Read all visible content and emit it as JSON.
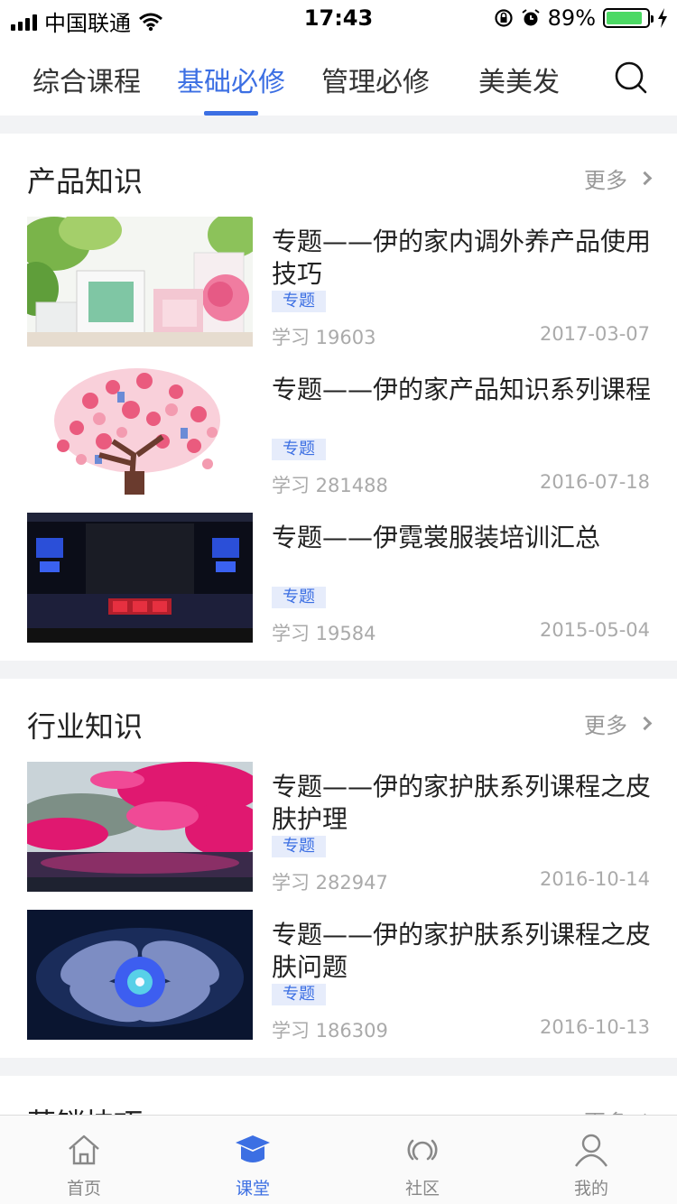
{
  "status_bar": {
    "carrier": "中国联通",
    "time": "17:43",
    "battery": "89%",
    "battery_level": 0.89,
    "icons": [
      "signal-icon",
      "wifi-icon",
      "rotation-lock-icon",
      "alarm-icon",
      "battery-icon",
      "charging-icon"
    ]
  },
  "top_tabs": {
    "items": [
      {
        "label": "综合课程",
        "active": false
      },
      {
        "label": "基础必修",
        "active": true
      },
      {
        "label": "管理必修",
        "active": false
      },
      {
        "label": "美美发",
        "active": false
      }
    ],
    "search_icon": "search-icon",
    "accent_color": "#3c6fe3"
  },
  "sections": [
    {
      "title": "产品知识",
      "more": "更多",
      "items": [
        {
          "title": "专题——伊的家内调外养产品使用技巧",
          "badge": "专题",
          "learn": "学习 19603",
          "date": "2017-03-07"
        },
        {
          "title": "专题——伊的家产品知识系列课程",
          "badge": "专题",
          "learn": "学习 281488",
          "date": "2016-07-18"
        },
        {
          "title": "专题——伊霓裳服装培训汇总",
          "badge": "专题",
          "learn": "学习 19584",
          "date": "2015-05-04"
        }
      ]
    },
    {
      "title": "行业知识",
      "more": "更多",
      "items": [
        {
          "title": "专题——伊的家护肤系列课程之皮肤护理",
          "badge": "专题",
          "learn": "学习 282947",
          "date": "2016-10-14"
        },
        {
          "title": "专题——伊的家护肤系列课程之皮肤问题",
          "badge": "专题",
          "learn": "学习 186309",
          "date": "2016-10-13"
        }
      ]
    },
    {
      "title": "营销技巧",
      "more": "更多",
      "items": []
    }
  ],
  "tab_bar": {
    "items": [
      {
        "label": "首页",
        "icon": "home-icon",
        "active": false
      },
      {
        "label": "课堂",
        "icon": "graduation-cap-icon",
        "active": true
      },
      {
        "label": "社区",
        "icon": "community-icon",
        "active": false
      },
      {
        "label": "我的",
        "icon": "profile-icon",
        "active": false
      }
    ]
  }
}
